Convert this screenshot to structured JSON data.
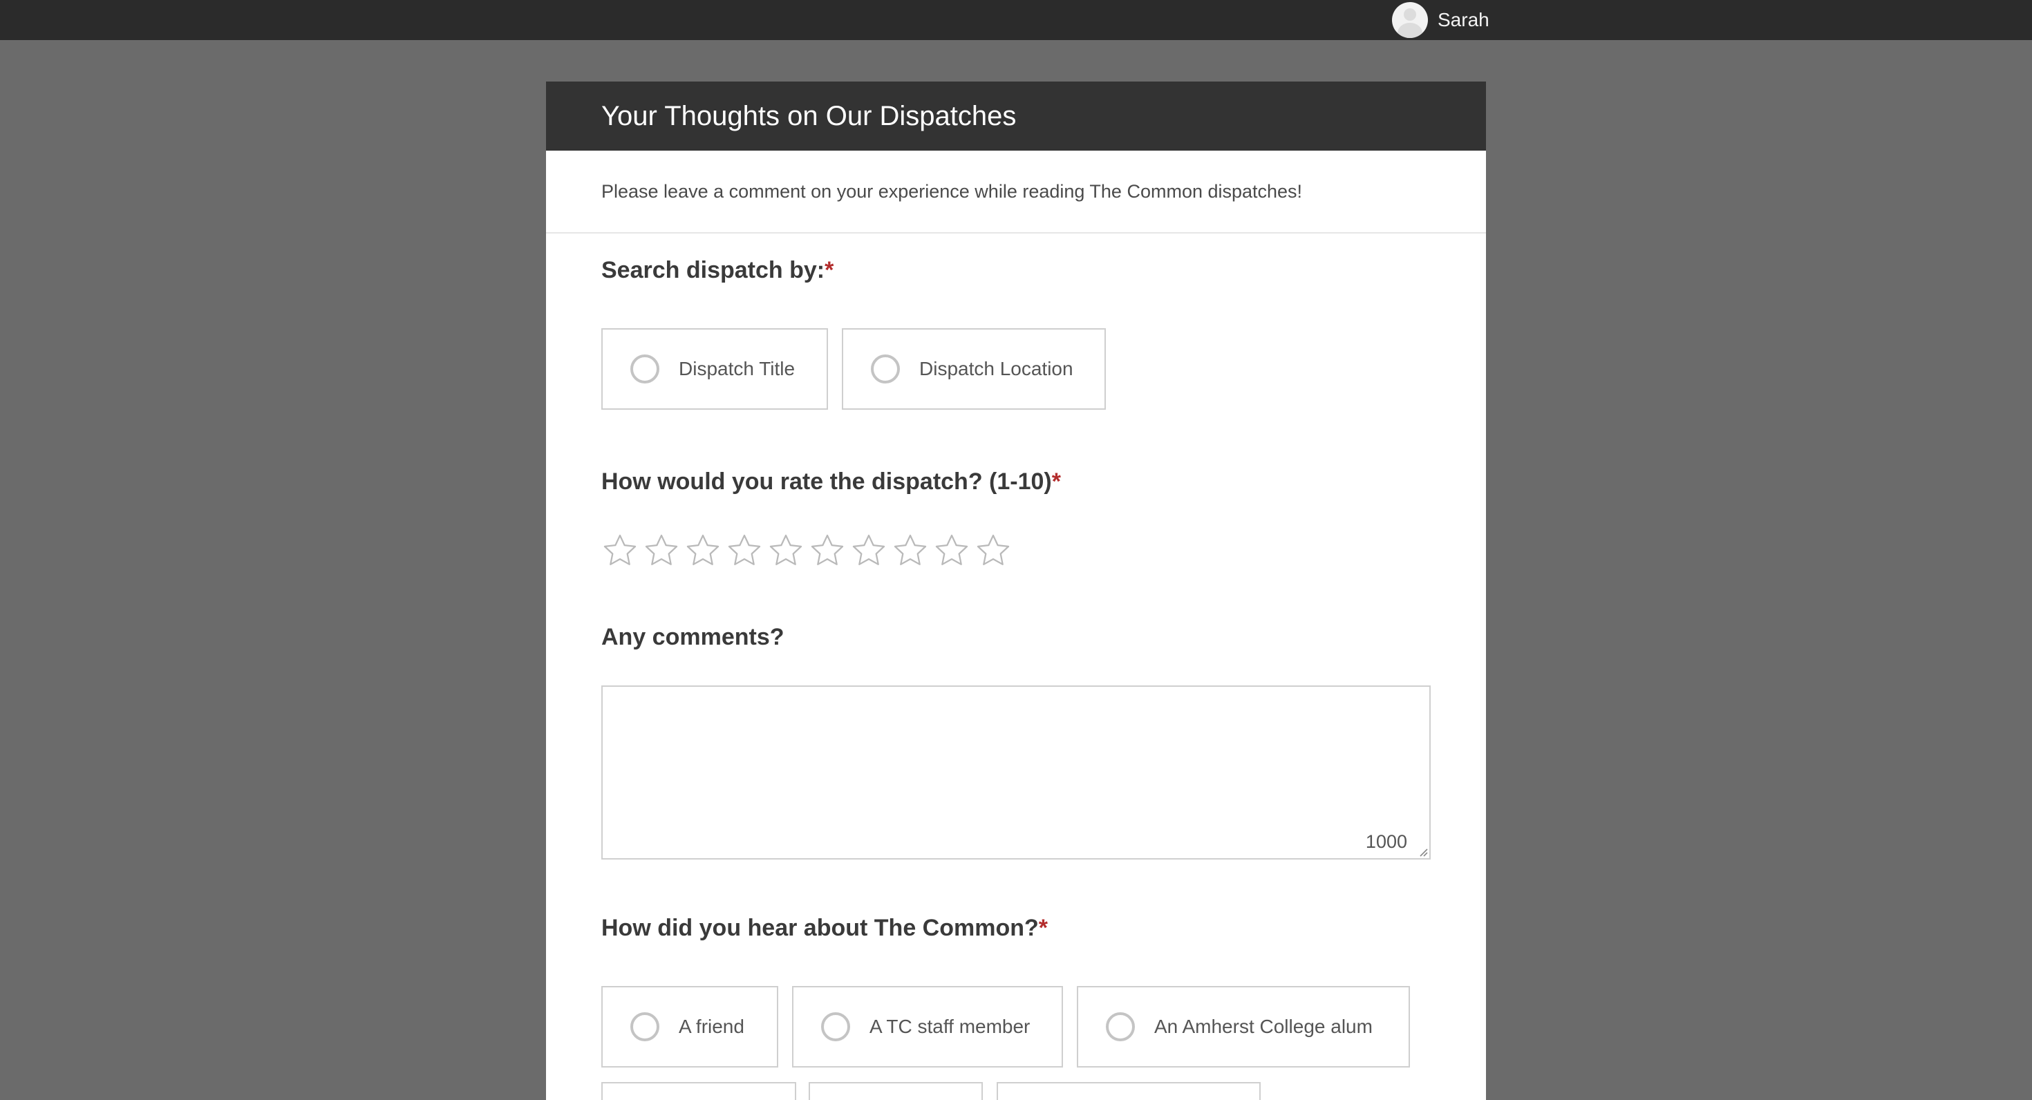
{
  "topbar": {
    "user_name": "Sarah"
  },
  "form": {
    "title": "Your Thoughts on Our Dispatches",
    "description": "Please leave a comment on your experience while reading The Common dispatches!",
    "required_mark": "*",
    "search_by": {
      "label": "Search dispatch by:",
      "options": [
        "Dispatch Title",
        "Dispatch Location"
      ]
    },
    "rating": {
      "label": "How would you rate the dispatch? (1-10)",
      "star_count": 10,
      "selected": 0
    },
    "comments": {
      "label": "Any comments?",
      "value": "",
      "char_counter": "1000"
    },
    "hear_about": {
      "label": "How did you hear about The Common?",
      "options": [
        "A friend",
        "A TC staff member",
        "An Amherst College alum"
      ]
    }
  },
  "colors": {
    "topbar": "#2b2b2b",
    "page_background": "#6b6b6b",
    "header": "#333333",
    "required": "#b32d2d",
    "border": "#cfcfcf"
  }
}
